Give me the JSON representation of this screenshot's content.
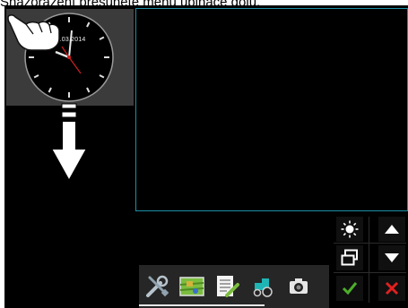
{
  "header": {
    "caption": "Shazoražení přesunete menu uplnace dolů."
  },
  "clock": {
    "date": "18.03.2014",
    "time_hours": 10,
    "time_minutes": 58
  },
  "toolbar": {
    "items": [
      {
        "name": "settings",
        "icon": "wrench-screwdriver-icon"
      },
      {
        "name": "field-map",
        "icon": "field-map-icon"
      },
      {
        "name": "task-list",
        "icon": "checklist-icon"
      },
      {
        "name": "tractor",
        "icon": "tractor-icon"
      },
      {
        "name": "camera",
        "icon": "camera-icon"
      }
    ]
  },
  "side_controls": {
    "brightness_icon": "brightness-icon",
    "window_switch_icon": "window-switch-icon",
    "up_icon": "arrow-up-icon",
    "down_icon": "arrow-down-icon",
    "confirm_icon": "confirm-check-icon",
    "cancel_icon": "cancel-x-icon"
  },
  "colors": {
    "accent_border": "#1e8fa8",
    "confirm": "#4caf2a",
    "cancel": "#e02020"
  }
}
